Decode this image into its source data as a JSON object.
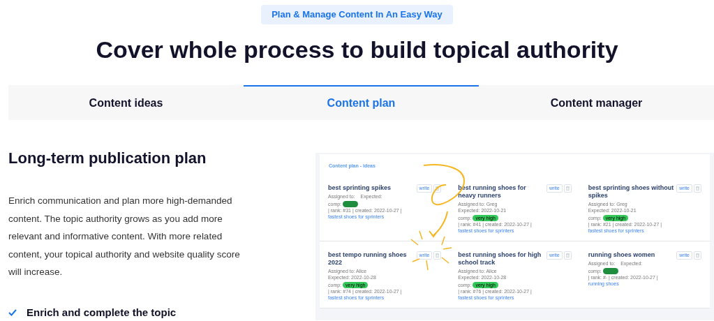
{
  "badge": "Plan & Manage Content In An Easy Way",
  "heading": "Cover whole process to build topical authority",
  "tabs": [
    {
      "label": "Content ideas",
      "selected": false
    },
    {
      "label": "Content plan",
      "selected": true
    },
    {
      "label": "Content manager",
      "selected": false
    }
  ],
  "section": {
    "title": "Long-term publication plan",
    "text": "Enrich communication and plan more high-demanded content. The topic authority grows as you add more relevant and informative content. With more related content, your topical authority and website quality score will increase.",
    "checklist": [
      {
        "label": "Enrich and complete the topic",
        "checked": true
      }
    ]
  },
  "preview": {
    "header": "Content plan - ideas",
    "cards": [
      {
        "title": "best sprinting spikes",
        "assigned": "Assigned to:",
        "expected": "Expected:",
        "comp": "comp:",
        "color": "#1e8e3e",
        "meta": "| rank: #31 | created: 2022-10-27 |",
        "link": "fastest shoes for sprinters",
        "write": "write"
      },
      {
        "title": "best running shoes for heavy runners",
        "assigned": "Assigned to: Greg",
        "expected": "Expected: 2022-10-21",
        "comp": "comp:",
        "level_label": "very high",
        "color": "#34c759",
        "meta": "| rank: #41 | created: 2022-10-27 |",
        "link": "fastest shoes for sprinters",
        "write": "write"
      },
      {
        "title": "best sprinting shoes without spikes",
        "assigned": "Assigned to: Greg",
        "expected": "Expected: 2022-10-21",
        "comp": "comp:",
        "level_label": "very high",
        "color": "#34c759",
        "meta": "| rank: #21 | created: 2022-10-27 |",
        "link": "fastest shoes for sprinters",
        "write": "write"
      },
      {
        "title": "best tempo running shoes 2022",
        "assigned": "Assigned to: Alice",
        "expected": "Expected: 2022-10-28",
        "comp": "comp:",
        "level_label": "very high",
        "color": "#34c759",
        "meta": "| rank: #74 | created: 2022-10-27 |",
        "link": "fastest shoes for sprinters",
        "write": "write"
      },
      {
        "title": "best running shoes for high school track",
        "assigned": "Assigned to: Alice",
        "expected": "Expected: 2022-10-28",
        "comp": "comp:",
        "level_label": "very high",
        "color": "#34c759",
        "meta": "| rank: #76 | created: 2022-10-27 |",
        "link": "fastest shoes for sprinters",
        "write": "write"
      },
      {
        "title": "running shoes women",
        "assigned": "Assigned to:",
        "expected": "Expected:",
        "comp": "comp:",
        "color": "#1e8e3e",
        "meta": "| rank: #- | created: 2022-10-27 |",
        "link": "running shoes",
        "write": "write"
      }
    ]
  }
}
